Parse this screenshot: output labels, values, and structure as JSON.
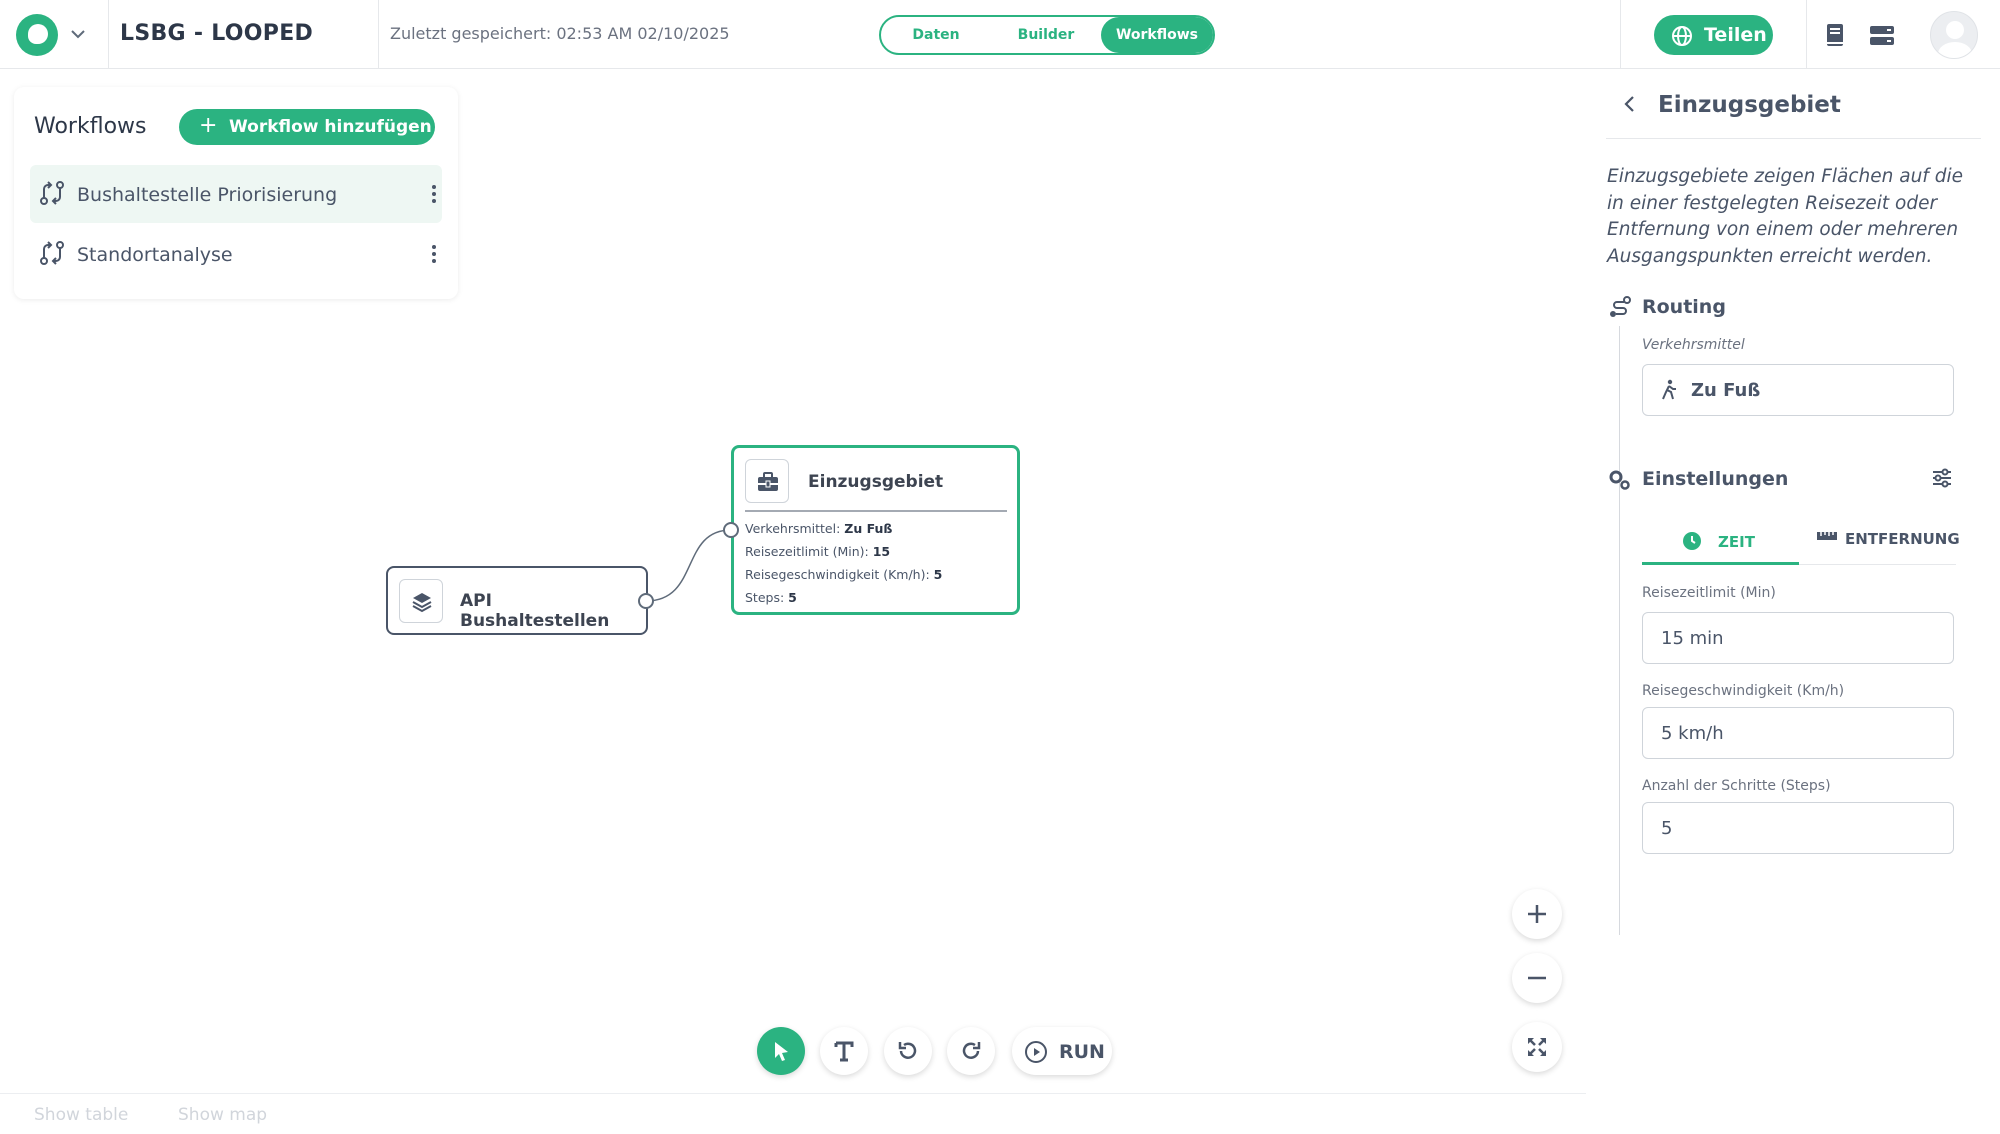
{
  "header": {
    "project_title": "LSBG - LOOPED",
    "saved_text": "Zuletzt gespeichert: 02:53 AM 02/10/2025",
    "tabs": [
      {
        "label": "Daten",
        "active": false
      },
      {
        "label": "Builder",
        "active": false
      },
      {
        "label": "Workflows",
        "active": true
      }
    ],
    "share_label": "Teilen",
    "accent_color": "#2bb381"
  },
  "workflows_panel": {
    "title": "Workflows",
    "add_label": "Workflow hinzufügen",
    "items": [
      {
        "label": "Bushaltestelle Priorisierung",
        "selected": true
      },
      {
        "label": "Standortanalyse",
        "selected": false
      }
    ]
  },
  "canvas": {
    "source_node": {
      "label": "API Bushaltestellen",
      "icon": "layers-icon"
    },
    "tool_node": {
      "label": "Einzugsgebiet",
      "icon": "toolbox-icon",
      "rows": [
        {
          "key": "Verkehrsmittel:",
          "value": "Zu Fuß"
        },
        {
          "key": "Reisezeitlimit (Min):",
          "value": "15"
        },
        {
          "key": "Reisegeschwindigkeit (Km/h):",
          "value": "5"
        },
        {
          "key": "Steps:",
          "value": "5"
        }
      ]
    },
    "run_label": "RUN"
  },
  "bottom_bar": {
    "show_table": "Show table",
    "show_map": "Show map"
  },
  "right_panel": {
    "title": "Einzugsgebiet",
    "description": "Einzugsgebiete zeigen Flächen auf die in einer festgelegten Reisezeit oder Entfernung von einem oder mehreren Ausgangspunkten erreicht werden.",
    "routing": {
      "title": "Routing",
      "mode_label": "Verkehrsmittel",
      "mode_value": "Zu Fuß"
    },
    "settings": {
      "title": "Einstellungen",
      "tabs": [
        {
          "label": "ZEIT",
          "active": true
        },
        {
          "label": "ENTFERNUNG",
          "active": false
        }
      ],
      "fields": [
        {
          "label": "Reisezeitlimit (Min)",
          "value": "15 min"
        },
        {
          "label": "Reisegeschwindigkeit (Km/h)",
          "value": "5 km/h"
        },
        {
          "label": "Anzahl der Schritte (Steps)",
          "value": "5"
        }
      ]
    }
  }
}
